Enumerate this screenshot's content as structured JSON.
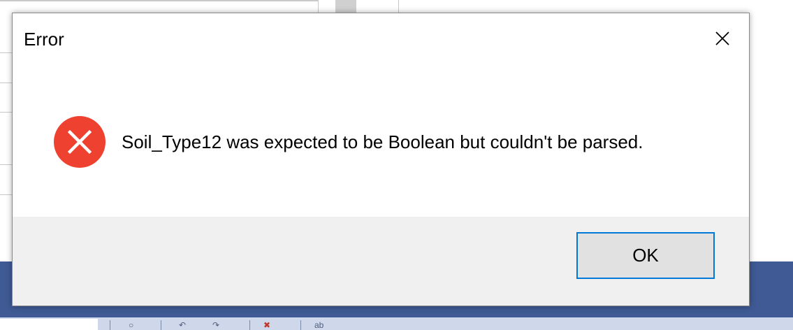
{
  "dialog": {
    "title": "Error",
    "message": "Soil_Type12 was expected to be Boolean but couldn't be parsed.",
    "ok_label": "OK",
    "icon": "error-icon",
    "close_icon": "close-icon"
  },
  "background": {
    "toolbar_text": "ab"
  },
  "colors": {
    "error_red": "#ef4130",
    "focus_border": "#0078d7",
    "footer_bg": "#f0f0f0",
    "taskbar_blue": "#3f5a94"
  }
}
